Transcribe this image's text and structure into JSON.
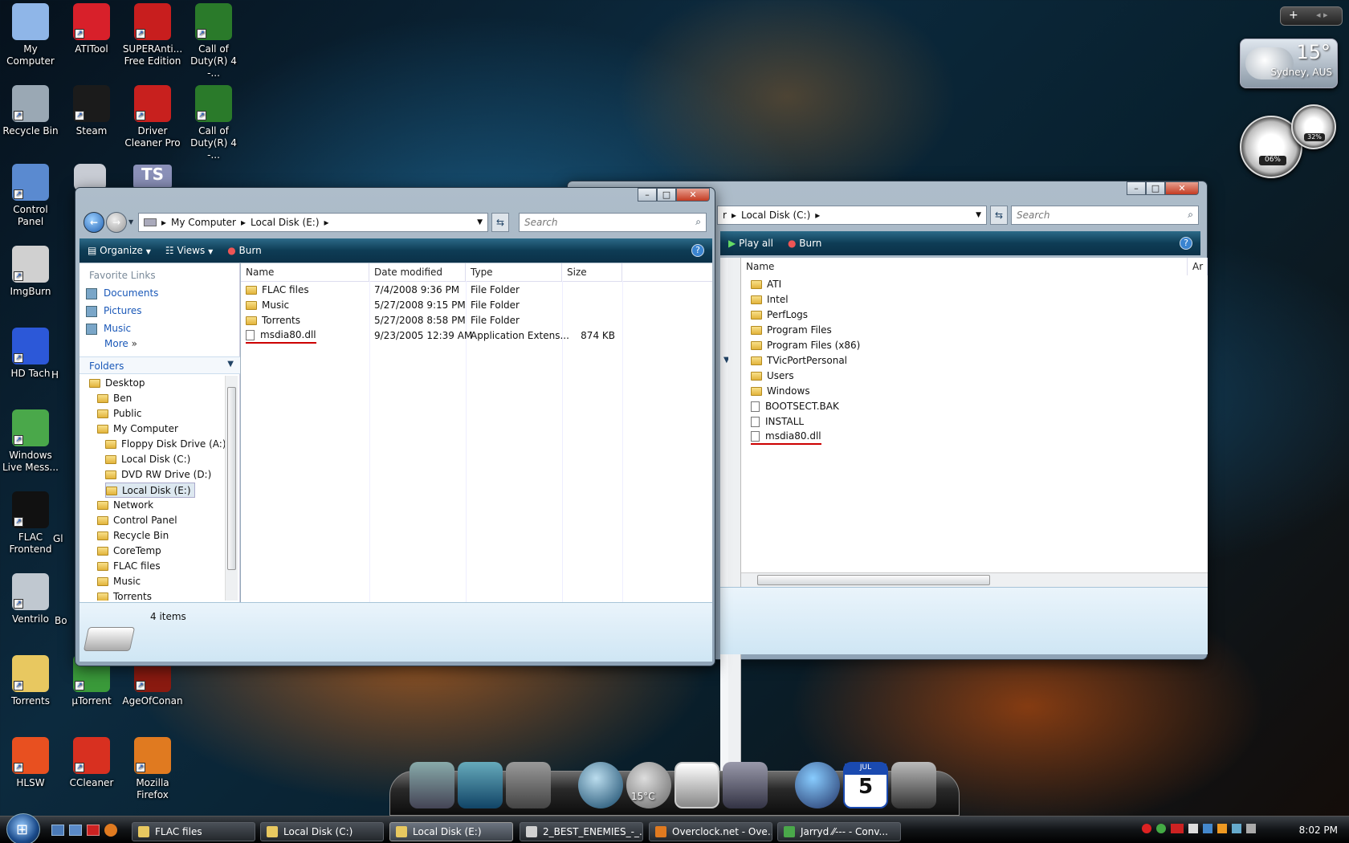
{
  "desktop_icons": [
    {
      "label": "My Computer",
      "icon": "computer-icon",
      "col": 0,
      "row": 0,
      "color": "#8fb6e8"
    },
    {
      "label": "ATITool",
      "icon": "atitool-icon",
      "col": 1,
      "row": 0,
      "color": "#d8202a"
    },
    {
      "label": "SUPERAnti... Free Edition",
      "icon": "superantispyware-icon",
      "col": 2,
      "row": 0,
      "color": "#c81e1e"
    },
    {
      "label": "Call of Duty(R) 4 -...",
      "icon": "call-of-duty-icon",
      "col": 3,
      "row": 0,
      "color": "#2a7a2a"
    },
    {
      "label": "Recycle Bin",
      "icon": "recycle-bin-icon",
      "col": 0,
      "row": 1,
      "color": "#9aa8b4"
    },
    {
      "label": "Steam",
      "icon": "steam-icon",
      "col": 1,
      "row": 1,
      "color": "#1b1b1b"
    },
    {
      "label": "Driver Cleaner Pro",
      "icon": "driver-cleaner-icon",
      "col": 2,
      "row": 1,
      "color": "#c8201e"
    },
    {
      "label": "Call of Duty(R) 4 -...",
      "icon": "call-of-duty-icon",
      "col": 3,
      "row": 1,
      "color": "#2a7a2a"
    },
    {
      "label": "Control Panel",
      "icon": "control-panel-icon",
      "col": 0,
      "row": 2,
      "color": "#5a8ad0"
    },
    {
      "label": "ImgBurn",
      "icon": "imgburn-icon",
      "col": 0,
      "row": 3,
      "color": "#d0d0d0"
    },
    {
      "label": "HD Tach",
      "icon": "hd-tach-icon",
      "col": 0,
      "row": 4,
      "color": "#2c58d8"
    },
    {
      "label": "Windows Live Mess...",
      "icon": "windows-live-messenger-icon",
      "col": 0,
      "row": 5,
      "color": "#4aa84a"
    },
    {
      "label": "FLAC Frontend",
      "icon": "flac-icon",
      "col": 0,
      "row": 6,
      "color": "#111111"
    },
    {
      "label": "Ventrilo",
      "icon": "ventrilo-icon",
      "col": 0,
      "row": 7,
      "color": "#c0c8d0"
    },
    {
      "label": "Torrents",
      "icon": "folder-icon",
      "col": 0,
      "row": 8,
      "color": "#e8c860"
    },
    {
      "label": "µTorrent",
      "icon": "utorrent-icon",
      "col": 1,
      "row": 8,
      "color": "#3a9a3a"
    },
    {
      "label": "AgeOfConan",
      "icon": "age-of-conan-icon",
      "col": 2,
      "row": 8,
      "color": "#8a1a10"
    },
    {
      "label": "HLSW",
      "icon": "hlsw-icon",
      "col": 0,
      "row": 9,
      "color": "#e85020"
    },
    {
      "label": "CCleaner",
      "icon": "ccleaner-icon",
      "col": 1,
      "row": 9,
      "color": "#d83020"
    },
    {
      "label": "Mozilla Firefox",
      "icon": "firefox-icon",
      "col": 2,
      "row": 9,
      "color": "#e07a20"
    }
  ],
  "partial_labels": {
    "h": "H",
    "g": "Gl",
    "b": "Bo"
  },
  "weather": {
    "temp": "15°",
    "location": "Sydney, AUS"
  },
  "meters": {
    "cpu": "06%",
    "ram": "32%"
  },
  "window_e": {
    "address": [
      "My Computer",
      "Local Disk (E:)"
    ],
    "search_placeholder": "Search",
    "toolbar": {
      "organize": "Organize",
      "views": "Views",
      "burn": "Burn"
    },
    "favorite_links_title": "Favorite Links",
    "favorite_links": [
      "Documents",
      "Pictures",
      "Music"
    ],
    "more": "More",
    "folders_title": "Folders",
    "tree": [
      {
        "label": "Desktop",
        "indent": 0
      },
      {
        "label": "Ben",
        "indent": 1
      },
      {
        "label": "Public",
        "indent": 1
      },
      {
        "label": "My Computer",
        "indent": 1
      },
      {
        "label": "Floppy Disk Drive (A:)",
        "indent": 2
      },
      {
        "label": "Local Disk (C:)",
        "indent": 2
      },
      {
        "label": "DVD RW Drive (D:)",
        "indent": 2
      },
      {
        "label": "Local Disk (E:)",
        "indent": 2,
        "selected": true
      },
      {
        "label": "Network",
        "indent": 1
      },
      {
        "label": "Control Panel",
        "indent": 1
      },
      {
        "label": "Recycle Bin",
        "indent": 1
      },
      {
        "label": "CoreTemp",
        "indent": 1
      },
      {
        "label": "FLAC files",
        "indent": 1
      },
      {
        "label": "Music",
        "indent": 1
      },
      {
        "label": "Torrents",
        "indent": 1
      }
    ],
    "columns": [
      "Name",
      "Date modified",
      "Type",
      "Size"
    ],
    "files": [
      {
        "name": "FLAC files",
        "date": "7/4/2008 9:36 PM",
        "type": "File Folder",
        "size": "",
        "kind": "folder"
      },
      {
        "name": "Music",
        "date": "5/27/2008 9:15 PM",
        "type": "File Folder",
        "size": "",
        "kind": "folder"
      },
      {
        "name": "Torrents",
        "date": "5/27/2008 8:58 PM",
        "type": "File Folder",
        "size": "",
        "kind": "folder"
      },
      {
        "name": "msdia80.dll",
        "date": "9/23/2005 12:39 AM",
        "type": "Application Extens...",
        "size": "874 KB",
        "kind": "file"
      }
    ],
    "status": "4 items"
  },
  "window_c": {
    "address": [
      "r",
      "Local Disk (C:)"
    ],
    "search_placeholder": "Search",
    "toolbar": {
      "play_all": "Play all",
      "burn": "Burn"
    },
    "columns": [
      "Name",
      "Ar"
    ],
    "files": [
      {
        "name": "ATI",
        "kind": "folder"
      },
      {
        "name": "Intel",
        "kind": "folder"
      },
      {
        "name": "PerfLogs",
        "kind": "folder"
      },
      {
        "name": "Program Files",
        "kind": "folder"
      },
      {
        "name": "Program Files (x86)",
        "kind": "folder"
      },
      {
        "name": "TVicPortPersonal",
        "kind": "folder"
      },
      {
        "name": "Users",
        "kind": "folder"
      },
      {
        "name": "Windows",
        "kind": "folder"
      },
      {
        "name": "BOOTSECT.BAK",
        "kind": "file"
      },
      {
        "name": "INSTALL",
        "kind": "file"
      },
      {
        "name": "msdia80.dll",
        "kind": "file"
      }
    ]
  },
  "dock": {
    "temp": "15°C",
    "calendar_month": "JUL",
    "calendar_day": "5"
  },
  "taskbar": {
    "buttons": [
      {
        "label": "FLAC files",
        "color": "#e8c860"
      },
      {
        "label": "Local Disk (C:)",
        "color": "#e8c860"
      },
      {
        "label": "Local Disk (E:)",
        "color": "#e8c860",
        "active": true
      },
      {
        "label": "2_BEST_ENEMIES_-_...",
        "color": "#d0d0d0"
      },
      {
        "label": "Overclock.net - Ove...",
        "color": "#e07a20"
      },
      {
        "label": "Jarryd ⁄⁄--- - Conv...",
        "color": "#4aa84a"
      }
    ],
    "clock": "8:02 PM"
  }
}
